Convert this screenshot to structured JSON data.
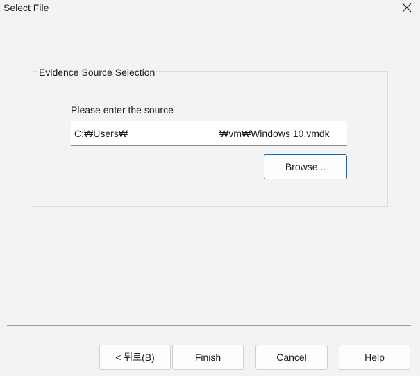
{
  "window": {
    "title": "Select File",
    "close_icon": "close-icon"
  },
  "group": {
    "legend": "Evidence Source Selection",
    "source_label": "Please enter the source",
    "path_head": "C:₩Users₩",
    "path_tail": "₩vm₩Windows 10.vmdk",
    "browse_label": "Browse..."
  },
  "footer": {
    "back_label": "< 뒤로(B)",
    "finish_label": "Finish",
    "cancel_label": "Cancel",
    "help_label": "Help"
  }
}
